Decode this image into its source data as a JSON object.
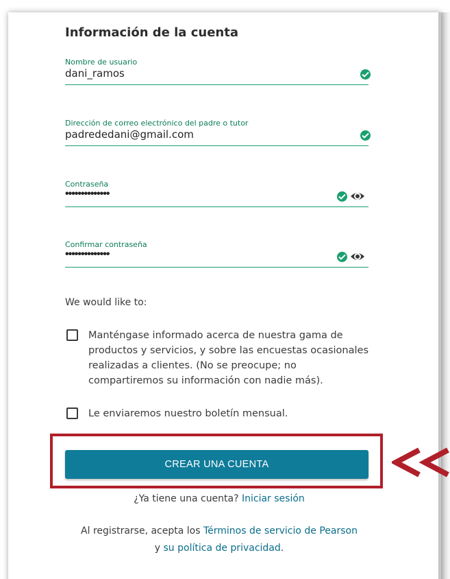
{
  "section_title": "Información de la cuenta",
  "fields": [
    {
      "label": "Nombre de usuario",
      "value": "dani_ramos"
    },
    {
      "label": "Dirección de correo electrónico del padre o tutor",
      "value": "padrededani@gmail.com"
    },
    {
      "label": "Contraseña",
      "value": "••••••••••••••"
    },
    {
      "label": "Confirmar contraseña",
      "value": "••••••••••••••"
    }
  ],
  "preferences": {
    "intro": "We would like to:",
    "options": [
      {
        "label": "Manténgase informado acerca de nuestra gama de productos y servicios, y sobre las encuestas ocasionales realizadas a clientes. (No se preocupe; no compartiremos su información con nadie más).",
        "checked": false
      },
      {
        "label": "Le enviaremos nuestro boletín mensual.",
        "checked": false
      }
    ]
  },
  "create_button": "CREAR UNA CUENTA",
  "login": {
    "prompt": "¿Ya tiene una cuenta?",
    "link": "Iniciar sesión"
  },
  "terms": {
    "prefix": "Al registrarse, acepta los",
    "terms_link": "Términos de servicio de Pearson",
    "conjunction": "y",
    "privacy_link": "su política de privacidad",
    "suffix": "."
  },
  "icons": {
    "valid": "check-circle-icon",
    "reveal": "eye-icon",
    "annotation": "double-chevron-left-icon"
  },
  "colors": {
    "accent_green": "#19a06e",
    "button": "#0f7c99",
    "link": "#0a6d8a",
    "highlight": "#b0202a"
  }
}
